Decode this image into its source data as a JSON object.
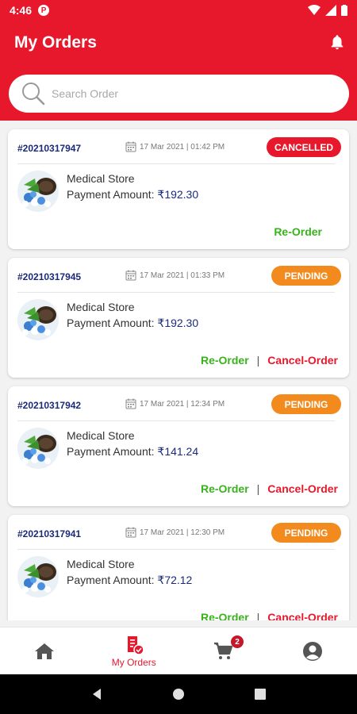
{
  "status_bar": {
    "time": "4:46",
    "app_icon_letter": "P"
  },
  "header": {
    "title": "My Orders"
  },
  "search": {
    "placeholder": "Search Order"
  },
  "colors": {
    "brand": "#e8182c",
    "cancelled": "#e8182c",
    "pending": "#f28a1e",
    "reorder": "#38b31c",
    "order_id": "#1a2a7a"
  },
  "orders": [
    {
      "id": "#20210317947",
      "date": "17 Mar 2021 | 01:42 PM",
      "status": "CANCELLED",
      "store": "Medical Store",
      "amount_label": "Payment Amount:",
      "amount": "₹192.30",
      "reorder": "Re-Order",
      "separator": "",
      "cancel": ""
    },
    {
      "id": "#20210317945",
      "date": "17 Mar 2021 | 01:33 PM",
      "status": "PENDING",
      "store": "Medical Store",
      "amount_label": "Payment Amount:",
      "amount": "₹192.30",
      "reorder": "Re-Order",
      "separator": "|",
      "cancel": "Cancel-Order"
    },
    {
      "id": "#20210317942",
      "date": "17 Mar 2021 | 12:34 PM",
      "status": "PENDING",
      "store": "Medical Store",
      "amount_label": "Payment Amount:",
      "amount": "₹141.24",
      "reorder": "Re-Order",
      "separator": "|",
      "cancel": "Cancel-Order"
    },
    {
      "id": "#20210317941",
      "date": "17 Mar 2021 | 12:30 PM",
      "status": "PENDING",
      "store": "Medical Store",
      "amount_label": "Payment Amount:",
      "amount": "₹72.12",
      "reorder": "Re-Order",
      "separator": "|",
      "cancel": "Cancel-Order"
    }
  ],
  "bottom_nav": {
    "items": [
      {
        "icon": "home-icon",
        "label": ""
      },
      {
        "icon": "orders-icon",
        "label": "My Orders"
      },
      {
        "icon": "cart-icon",
        "label": "",
        "badge": "2"
      },
      {
        "icon": "account-icon",
        "label": ""
      }
    ]
  }
}
